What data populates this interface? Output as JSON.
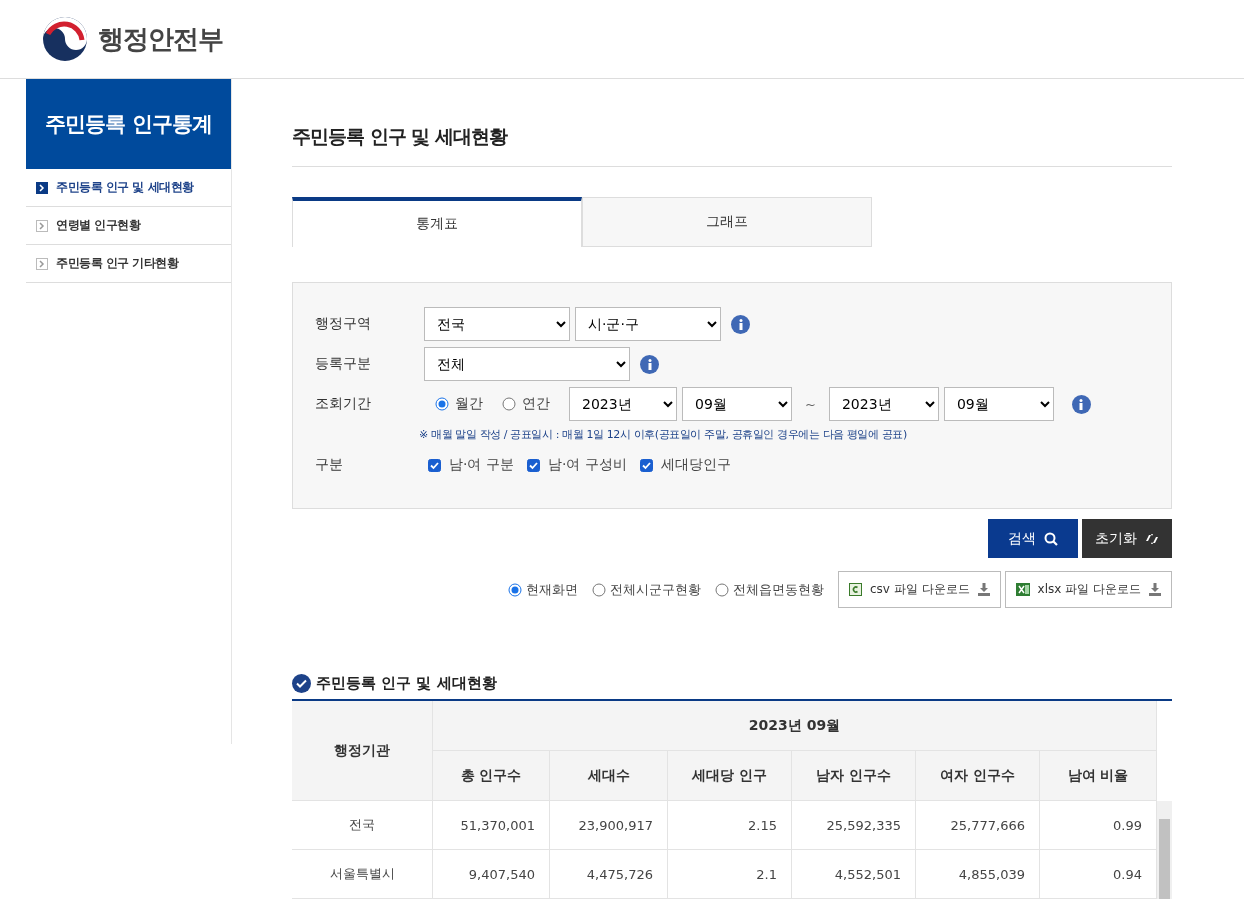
{
  "header": {
    "logo_text": "행정안전부"
  },
  "sidebar": {
    "title": "주민등록 인구통계",
    "items": [
      {
        "label": "주민등록 인구 및 세대현황",
        "selected": true
      },
      {
        "label": "연령별 인구현황",
        "selected": false
      },
      {
        "label": "주민등록 인구 기타현황",
        "selected": false
      }
    ]
  },
  "page_title": "주민등록 인구 및 세대현황",
  "tabs": [
    {
      "label": "통계표",
      "selected": true
    },
    {
      "label": "그래프",
      "selected": false
    }
  ],
  "filters": {
    "region": {
      "label": "행정구역",
      "selects": [
        "전국",
        "시·군·구"
      ]
    },
    "registration": {
      "label": "등록구분",
      "selects": [
        "전체"
      ]
    },
    "period": {
      "label": "조회기간",
      "radios": [
        {
          "label": "월간",
          "selected": true
        },
        {
          "label": "연간",
          "selected": false
        }
      ],
      "from": [
        "2023년",
        "09월"
      ],
      "separator": "~",
      "to": [
        "2023년",
        "09월"
      ],
      "note": "※ 매월 말일 작성 / 공표일시 : 매월 1일 12시 이후(공표일이 주말, 공휴일인 경우에는 다음 평일에 공표)"
    },
    "category": {
      "label": "구분",
      "checkboxes": [
        {
          "label": "남·여 구분",
          "checked": true
        },
        {
          "label": "남·여 구성비",
          "checked": true
        },
        {
          "label": "세대당인구",
          "checked": true
        }
      ]
    }
  },
  "buttons": {
    "search": "검색",
    "reset": "초기화"
  },
  "scope": [
    {
      "label": "현재화면",
      "selected": true
    },
    {
      "label": "전체시군구현황",
      "selected": false
    },
    {
      "label": "전체읍면동현황",
      "selected": false
    }
  ],
  "downloads": [
    {
      "kind": "csv",
      "label": "csv 파일 다운로드"
    },
    {
      "kind": "xlsx",
      "label": "xlsx 파일 다운로드"
    }
  ],
  "table": {
    "title": "주민등록 인구 및 세대현황",
    "first_header": "행정기관",
    "period_header": "2023년 09월",
    "columns": [
      "총 인구수",
      "세대수",
      "세대당 인구",
      "남자 인구수",
      "여자 인구수",
      "남여 비율"
    ],
    "rows": [
      {
        "name": "전국",
        "values": [
          "51,370,001",
          "23,900,917",
          "2.15",
          "25,592,335",
          "25,777,666",
          "0.99"
        ]
      },
      {
        "name": "서울특별시",
        "values": [
          "9,407,540",
          "4,475,726",
          "2.1",
          "4,552,501",
          "4,855,039",
          "0.94"
        ]
      }
    ]
  }
}
